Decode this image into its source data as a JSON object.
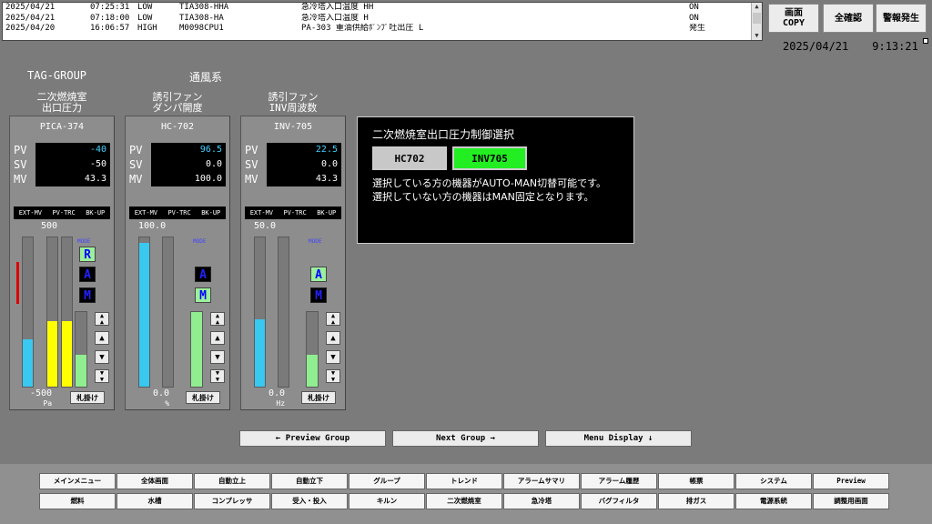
{
  "alarm_log": {
    "rows": [
      {
        "date": "2025/04/21",
        "time": "07:25:31",
        "level": "LOW",
        "tag": "TIA308-HHA",
        "desc": "急冷塔入口温度 HH",
        "status": "ON"
      },
      {
        "date": "2025/04/21",
        "time": "07:18:00",
        "level": "LOW",
        "tag": "TIA308-HA",
        "desc": "急冷塔入口温度 H",
        "status": "ON"
      },
      {
        "date": "2025/04/20",
        "time": "16:06:57",
        "level": "HIGH",
        "tag": "M0098CPU1",
        "desc": "PA-303 重油供給ﾎﾟﾝﾌﾟ吐出圧 L",
        "status": "発生"
      }
    ]
  },
  "top_buttons": {
    "copy": "画面\nCOPY",
    "ack_all": "全確認",
    "alarm": "警報発生"
  },
  "clock": {
    "date": "2025/04/21",
    "time": "9:13:21"
  },
  "header": {
    "tag_group": "TAG-GROUP",
    "group_name": "通風系"
  },
  "mode_header": [
    "EXT-MV",
    "PV-TRC",
    "BK-UP"
  ],
  "mode_label": "MODE",
  "tag_button_label": "札掛け",
  "panels": [
    {
      "title": "二次燃焼室\n出口圧力",
      "tag": "PICA-374",
      "pv": "-40",
      "sv": "-50",
      "mv": "43.3",
      "scale_top": "500",
      "scale_bottom": "-500",
      "unit": "Pa",
      "mode": "R",
      "bars": [
        0.32,
        0.44,
        0.44
      ],
      "alarm_level": 0.5,
      "mv_level": 0.43
    },
    {
      "title": "誘引ファン\nダンパ開度",
      "tag": "HC-702",
      "pv": "96.5",
      "sv": "0.0",
      "mv": "100.0",
      "scale_top": "100.0",
      "scale_bottom": "0.0",
      "unit": "%",
      "mode": "M",
      "bars": [
        0.965,
        0.0
      ],
      "mv_level": 1.0
    },
    {
      "title": "誘引ファン\nINV周波数",
      "tag": "INV-705",
      "pv": "22.5",
      "sv": "0.0",
      "mv": "43.3",
      "scale_top": "50.0",
      "scale_bottom": "0.0",
      "unit": "Hz",
      "mode": "A",
      "bars": [
        0.45,
        0.0
      ],
      "mv_level": 0.43
    }
  ],
  "labels": {
    "pv": "PV",
    "sv": "SV",
    "mv": "MV"
  },
  "dialog": {
    "title": "二次燃焼室出口圧力制御選択",
    "btn_hc": "HC702",
    "btn_inv": "INV705",
    "line1": "選択している方の機器がAUTO-MAN切替可能です。",
    "line2": "選択していない方の機器はMAN固定となります。"
  },
  "nav": {
    "prev": "← Preview Group",
    "next": "Next Group →",
    "menu": "Menu Display ↓"
  },
  "menu_row1": [
    "メインメニュー",
    "全体画面",
    "自動立上",
    "自動立下",
    "グループ",
    "トレンド",
    "アラームサマリ",
    "アラーム履歴",
    "帳票",
    "システム",
    "Preview"
  ],
  "menu_row2": [
    "燃料",
    "水槽",
    "コンプレッサ",
    "受入・投入",
    "キルン",
    "二次燃焼室",
    "急冷塔",
    "バグフィルタ",
    "排ガス",
    "電源系統",
    "調整用画面"
  ],
  "colors": {
    "pv": "#45d0ff",
    "value": "#ffffff",
    "bar_pv": "#38c8f0",
    "bar_sv": "#ffff00",
    "bar_mv": "#90ee90",
    "alarm": "#dd0000",
    "selected": "#22ee22"
  }
}
